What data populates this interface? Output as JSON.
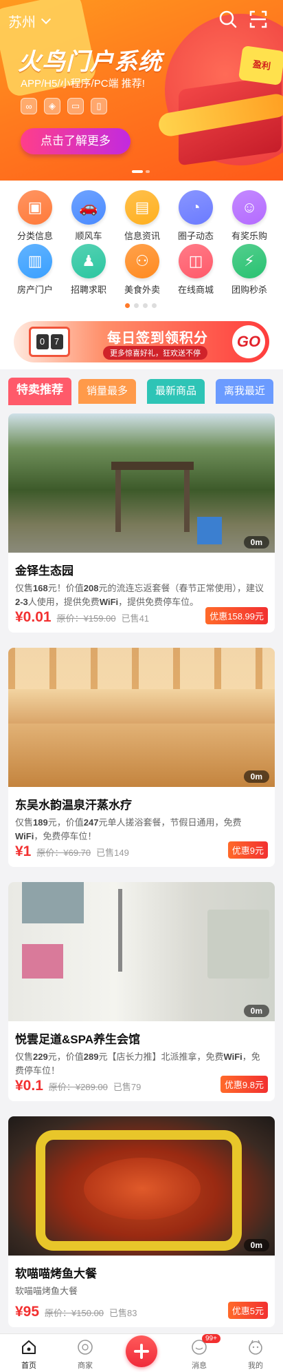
{
  "header": {
    "city": "苏州"
  },
  "banner": {
    "title": "火鸟门户系统",
    "subtitle": "APP/H5/小程序/PC端  推荐!",
    "cta": "点击了解更多",
    "coupon": "盈利",
    "feature_icons": [
      "link-icon",
      "cube-icon",
      "monitor-icon",
      "phone-icon"
    ],
    "slide_count": 2,
    "active_slide": 0
  },
  "categories": [
    {
      "label": "分类信息",
      "icon": "box-icon",
      "color": "#ff7a3a",
      "glyph": "▣"
    },
    {
      "label": "顺风车",
      "icon": "car-icon",
      "color": "#4a8bff",
      "glyph": "🚗"
    },
    {
      "label": "信息资讯",
      "icon": "news-icon",
      "color": "#ffb01f",
      "glyph": "▤"
    },
    {
      "label": "圈子动态",
      "icon": "circle-icon",
      "color": "#6b7bff",
      "glyph": "◔"
    },
    {
      "label": "有奖乐购",
      "icon": "gift-face-icon",
      "color": "#b46bff",
      "glyph": "☺"
    },
    {
      "label": "房产门户",
      "icon": "building-icon",
      "color": "#3aa0ff",
      "glyph": "▥"
    },
    {
      "label": "招聘求职",
      "icon": "person-icon",
      "color": "#2bc6a0",
      "glyph": "♟"
    },
    {
      "label": "美食外卖",
      "icon": "food-icon",
      "color": "#ff8a1f",
      "glyph": "⚇"
    },
    {
      "label": "在线商城",
      "icon": "bag-icon",
      "color": "#ff5a6a",
      "glyph": "◫"
    },
    {
      "label": "团购秒杀",
      "icon": "flash-icon",
      "color": "#28c271",
      "glyph": "⚡"
    }
  ],
  "category_pages": 4,
  "category_active_page": 0,
  "signin": {
    "title": "每日签到领积分",
    "subtitle": "更多惊喜好礼，狂欢送不停",
    "go": "GO",
    "calendar_digits": [
      "0",
      "7"
    ]
  },
  "tabs": [
    {
      "label": "特卖推荐",
      "color": "#ff5a6a",
      "active": true
    },
    {
      "label": "销量最多",
      "color": "#ff9a4a",
      "active": false
    },
    {
      "label": "最新商品",
      "color": "#2ec4b6",
      "active": false
    },
    {
      "label": "离我最近",
      "color": "#6b9bff",
      "active": false
    }
  ],
  "listings": [
    {
      "title": "金铎生态园",
      "desc_runs": [
        {
          "t": "仅售",
          "b": false
        },
        {
          "t": "168",
          "b": true
        },
        {
          "t": "元！价值",
          "b": false
        },
        {
          "t": "208",
          "b": true
        },
        {
          "t": "元的流连忘返套餐（春节正常使用），建议",
          "b": false
        },
        {
          "t": "2-3",
          "b": true
        },
        {
          "t": "人使用，提供免费",
          "b": false
        },
        {
          "t": "WiFi",
          "b": true
        },
        {
          "t": "，提供免费停车位。",
          "b": false
        }
      ],
      "price": "¥0.01",
      "orig_price": "原价：¥159.00",
      "sold": "已售41",
      "discount": "优惠158.99元",
      "distance": "0m",
      "photo": "park"
    },
    {
      "title": "东吴水韵温泉汗蒸水疗",
      "desc_runs": [
        {
          "t": "仅售",
          "b": false
        },
        {
          "t": "189",
          "b": true
        },
        {
          "t": "元，价值",
          "b": false
        },
        {
          "t": "247",
          "b": true
        },
        {
          "t": "元单人搓浴套餐，节假日通用，免费",
          "b": false
        },
        {
          "t": "WiFi",
          "b": true
        },
        {
          "t": "，免费停车位！",
          "b": false
        }
      ],
      "price": "¥1",
      "orig_price": "原价：¥69.70",
      "sold": "已售149",
      "discount": "优惠9元",
      "distance": "0m",
      "photo": "hall"
    },
    {
      "title": "悦雲足道&SPA养生会馆",
      "desc_runs": [
        {
          "t": "仅售",
          "b": false
        },
        {
          "t": "229",
          "b": true
        },
        {
          "t": "元，价值",
          "b": false
        },
        {
          "t": "289",
          "b": true
        },
        {
          "t": "元【店长力推】北派推拿，免费",
          "b": false
        },
        {
          "t": "WiFi",
          "b": true
        },
        {
          "t": "，免费停车位！",
          "b": false
        }
      ],
      "price": "¥0.1",
      "orig_price": "原价：¥289.00",
      "sold": "已售79",
      "discount": "优惠9.8元",
      "distance": "0m",
      "photo": "bath"
    },
    {
      "title": "软喵喵烤鱼大餐",
      "desc_runs": [
        {
          "t": "软喵喵烤鱼大餐",
          "b": false
        }
      ],
      "price": "¥95",
      "orig_price": "原价：¥150.00",
      "sold": "已售83",
      "discount": "优惠5元",
      "distance": "0m",
      "photo": "fish"
    }
  ],
  "nav": {
    "items": [
      {
        "label": "首页",
        "icon": "home-icon",
        "active": true
      },
      {
        "label": "商家",
        "icon": "store-icon",
        "active": false
      },
      {
        "label": "消息",
        "icon": "message-icon",
        "active": false,
        "badge": "99+"
      },
      {
        "label": "我的",
        "icon": "profile-icon",
        "active": false
      }
    ]
  }
}
